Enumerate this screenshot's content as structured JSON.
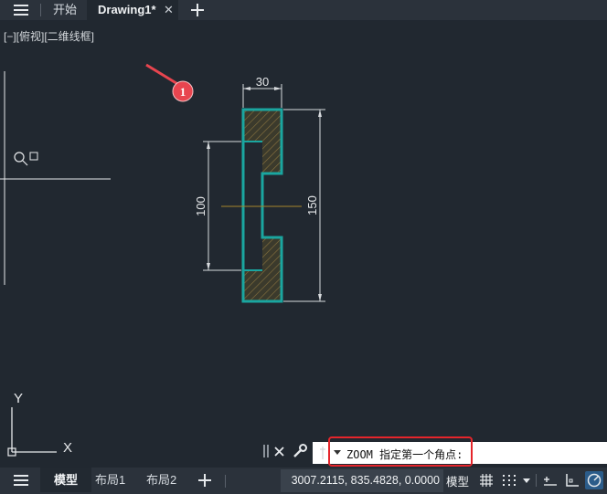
{
  "tabs": {
    "home_label": "开始",
    "drawing_label": "Drawing1*",
    "close_symbol": "✕"
  },
  "viewport": {
    "label": "[−][俯视][二维线框]"
  },
  "drawing": {
    "dimensions": {
      "width": "30",
      "height": "150",
      "inner": "100"
    },
    "marker_number": "1",
    "ucs": {
      "y_label": "Y",
      "x_label": "X"
    },
    "colors": {
      "outline": "#1aa6a0",
      "hatch": "#7a6a3a",
      "centerline": "#a8862c",
      "marker": "#e8454f"
    }
  },
  "command": {
    "text": "ZOOM 指定第一个角点:",
    "highlight_color": "#e5252b"
  },
  "layout_tabs": [
    "模型",
    "布局1",
    "布局2"
  ],
  "status": {
    "coordinates": "3007.2115, 835.4828, 0.0000",
    "model_label": "模型"
  }
}
